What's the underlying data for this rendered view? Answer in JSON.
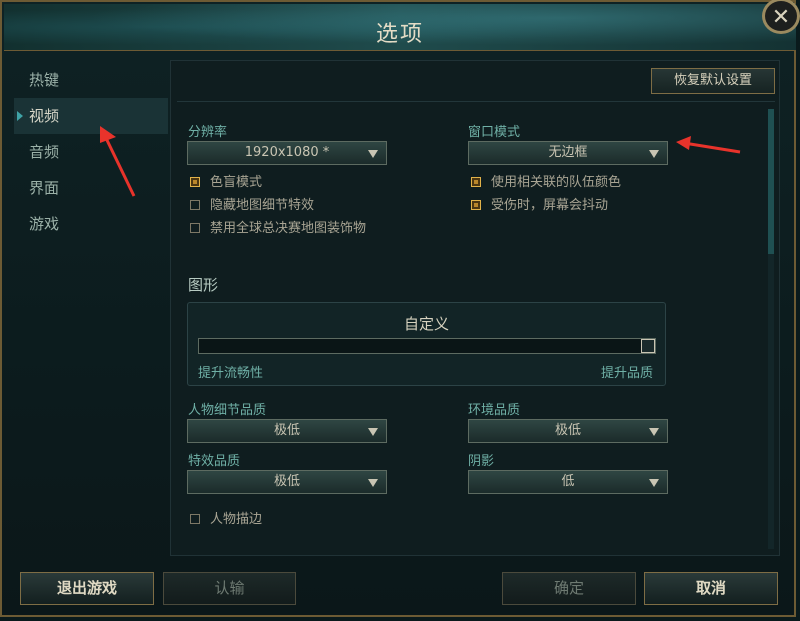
{
  "window": {
    "title": "选项",
    "close_label": "✕"
  },
  "sidebar": {
    "items": [
      {
        "label": "热键",
        "active": false
      },
      {
        "label": "视频",
        "active": true
      },
      {
        "label": "音频",
        "active": false
      },
      {
        "label": "界面",
        "active": false
      },
      {
        "label": "游戏",
        "active": false
      }
    ]
  },
  "panel": {
    "reset_label": "恢复默认设置",
    "resolution": {
      "label": "分辨率",
      "value": "1920x1080 *"
    },
    "window_mode": {
      "label": "窗口模式",
      "value": "无边框"
    },
    "left_checks": [
      {
        "label": "色盲模式",
        "checked": true
      },
      {
        "label": "隐藏地图细节特效",
        "checked": false
      },
      {
        "label": "禁用全球总决赛地图装饰物",
        "checked": false
      }
    ],
    "right_checks": [
      {
        "label": "使用相关联的队伍颜色",
        "checked": true
      },
      {
        "label": "受伤时，屏幕会抖动",
        "checked": true
      }
    ],
    "graphics": {
      "title": "图形",
      "preset": "自定义",
      "slider_min": "提升流畅性",
      "slider_max": "提升品质",
      "slider_level": 1.0
    },
    "character_quality": {
      "label": "人物细节品质",
      "value": "极低"
    },
    "environment_quality": {
      "label": "环境品质",
      "value": "极低"
    },
    "effects_quality": {
      "label": "特效品质",
      "value": "极低"
    },
    "shadows": {
      "label": "阴影",
      "value": "低"
    },
    "outline": {
      "label": "人物描边",
      "checked": false
    }
  },
  "footer": {
    "exit_label": "退出游戏",
    "acknowledge_label": "认输",
    "confirm_label": "确定",
    "cancel_label": "取消"
  },
  "colors": {
    "accent_gold": "#7e6d45",
    "annotation_red": "#e8332b",
    "check_on": "#b9862b"
  }
}
